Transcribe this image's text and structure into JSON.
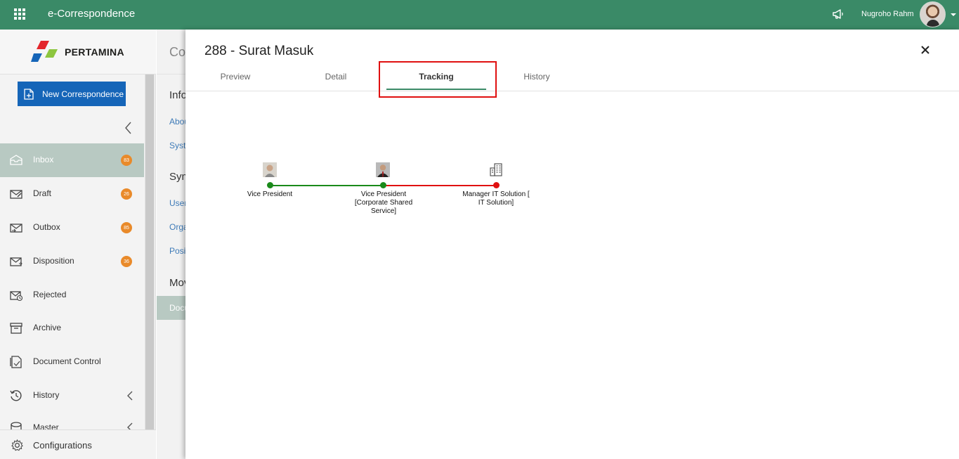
{
  "topbar": {
    "app_title": "e-Correspondence",
    "user_name": "Nugroho Rahm",
    "accent_color": "#3a8a67",
    "icons": [
      "apps-grid-icon",
      "megaphone-icon",
      "avatar",
      "caret-down-icon"
    ]
  },
  "sidebar": {
    "logo_text": "PERTAMINA",
    "new_button_label": "New Correspondence",
    "items": [
      {
        "label": "Inbox",
        "badge": "83",
        "icon": "inbox-icon",
        "active": true
      },
      {
        "label": "Draft",
        "badge": "26",
        "icon": "draft-icon"
      },
      {
        "label": "Outbox",
        "badge": "85",
        "icon": "outbox-icon"
      },
      {
        "label": "Disposition",
        "badge": "36",
        "icon": "disposition-icon"
      },
      {
        "label": "Rejected",
        "badge": "",
        "icon": "rejected-icon"
      },
      {
        "label": "Archive",
        "badge": "",
        "icon": "archive-icon"
      },
      {
        "label": "Document Control",
        "badge": "",
        "icon": "document-control-icon"
      },
      {
        "label": "History",
        "badge": "",
        "icon": "history-icon"
      },
      {
        "label": "Master",
        "badge": "",
        "icon": "master-icon"
      }
    ],
    "configurations_label": "Configurations"
  },
  "background": {
    "header": "Co",
    "lines": [
      "Info",
      "Abou",
      "Syste",
      "Sym",
      "User",
      "Orga",
      "Posit",
      "Mov"
    ],
    "selected": "Docu"
  },
  "panel": {
    "title": "288 - Surat Masuk",
    "tabs": [
      "Preview",
      "Detail",
      "Tracking",
      "History"
    ],
    "active_tab": "Tracking"
  },
  "tracking": {
    "nodes": [
      {
        "label": "Vice President",
        "status": "done",
        "avatar": "person-photo"
      },
      {
        "label": "Vice President [Corporate Shared Service]",
        "status": "done",
        "avatar": "person-photo"
      },
      {
        "label": "Manager IT Solution [ IT Solution]",
        "status": "pending",
        "avatar": "building-icon"
      }
    ],
    "colors": {
      "done": "#1a8a1a",
      "pending": "#e01010"
    }
  }
}
